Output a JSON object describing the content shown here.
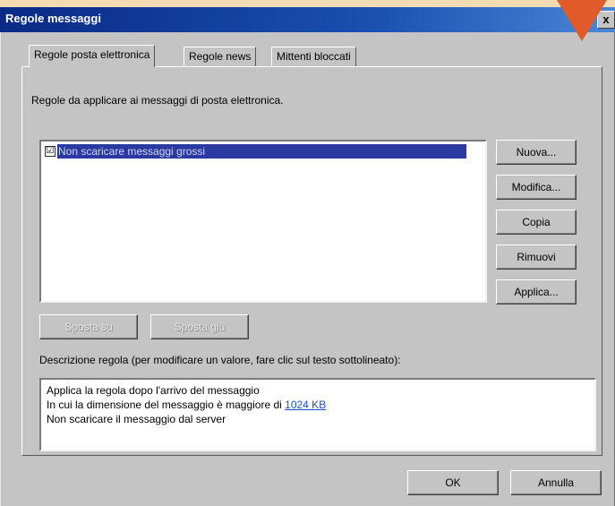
{
  "window": {
    "title": "Regole messaggi",
    "close_label": "x"
  },
  "tabs": [
    {
      "label": "Regole posta elettronica",
      "active": true
    },
    {
      "label": "Regole news",
      "active": false
    },
    {
      "label": "Mittenti bloccati",
      "active": false
    }
  ],
  "rules_intro": "Regole da applicare ai messaggi di posta elettronica.",
  "rules": [
    {
      "name": "Non scaricare messaggi grossi",
      "checked": true,
      "checkmark": "☑"
    }
  ],
  "side_buttons": {
    "new": "Nuova...",
    "modify": "Modifica...",
    "copy": "Copia",
    "remove": "Rimuovi",
    "apply": "Applica..."
  },
  "move_buttons": {
    "up": "Sposta su",
    "down": "Sposta giù"
  },
  "description": {
    "label": "Descrizione regola (per modificare un valore, fare clic sul testo sottolineato):",
    "line1": "Applica la regola dopo l'arrivo del messaggio",
    "line2_prefix": "In cui la dimensione del messaggio è maggiore di ",
    "line2_link": "1024 KB",
    "line3": "Non scaricare il messaggio dal server"
  },
  "footer_buttons": {
    "ok": "OK",
    "cancel": "Annulla"
  },
  "colors": {
    "title_bar": "#0a2a86",
    "selection": "#2b3aa0",
    "arrow": "#e05a2a",
    "page_bg": "#f3dcb4"
  }
}
